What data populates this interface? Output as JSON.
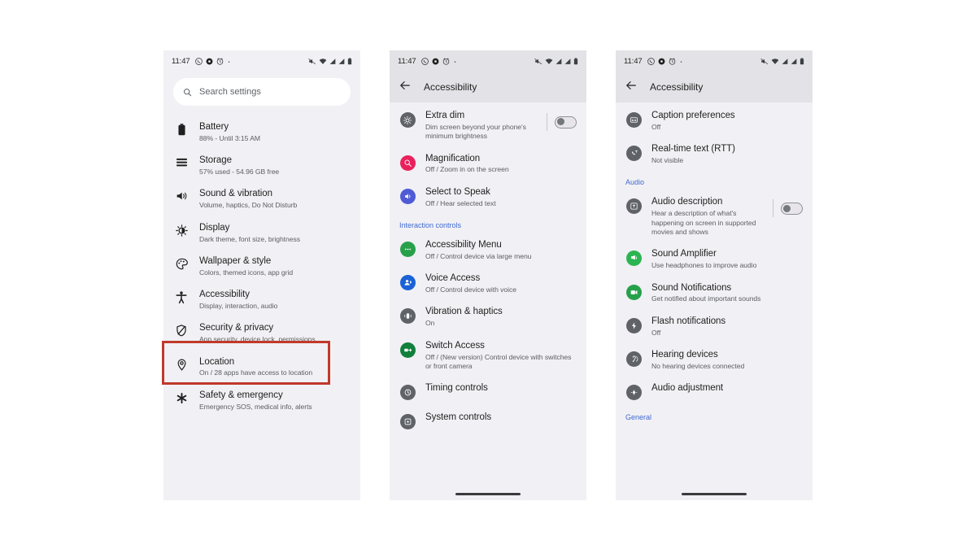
{
  "status_bar": {
    "time": "11:47",
    "left_icons": [
      "whatsapp-icon",
      "filled-circle-icon",
      "alarm-icon",
      "dot-icon"
    ],
    "right_icons": [
      "mute-icon",
      "wifi-icon",
      "signal-1-icon",
      "signal-2-icon",
      "battery-icon"
    ]
  },
  "colors": {
    "phone_bg": "#f1f0f4",
    "appbar_bg": "#e3e2e6",
    "highlight_red": "#c0392b",
    "section_blue": "#3f6ad1",
    "icon_grey": "#5f6368",
    "icon_pink": "#e8215c",
    "icon_blue_purple": "#4f5bd5",
    "icon_green": "#27a04a",
    "icon_blue": "#1a62d6",
    "icon_dark_green": "#11803c",
    "icon_light_green": "#2bb551"
  },
  "panel1": {
    "search": {
      "placeholder": "Search settings",
      "icon": "search-icon"
    },
    "items": [
      {
        "title": "Battery",
        "sub": "88% - Until 3:15 AM",
        "icon": "battery-icon"
      },
      {
        "title": "Storage",
        "sub": "57% used - 54.96 GB free",
        "icon": "storage-icon"
      },
      {
        "title": "Sound & vibration",
        "sub": "Volume, haptics, Do Not Disturb",
        "icon": "volume-icon"
      },
      {
        "title": "Display",
        "sub": "Dark theme, font size, brightness",
        "icon": "brightness-icon"
      },
      {
        "title": "Wallpaper & style",
        "sub": "Colors, themed icons, app grid",
        "icon": "palette-icon"
      },
      {
        "title": "Accessibility",
        "sub": "Display, interaction, audio",
        "icon": "accessibility-icon",
        "highlighted": true
      },
      {
        "title": "Security & privacy",
        "sub": "App security, device lock, permissions",
        "icon": "shield-icon"
      },
      {
        "title": "Location",
        "sub": "On / 28 apps have access to location",
        "icon": "location-pin-icon"
      },
      {
        "title": "Safety & emergency",
        "sub": "Emergency SOS, medical info, alerts",
        "icon": "asterisk-icon"
      }
    ]
  },
  "panel2": {
    "appbar": {
      "title": "Accessibility",
      "back_icon": "back-arrow-icon"
    },
    "items": [
      {
        "type": "item",
        "title": "Extra dim",
        "sub": "Dim screen beyond your phone's minimum brightness",
        "icon": "extra-dim-icon",
        "icon_color": "#5f6368",
        "toggle": "off"
      },
      {
        "type": "item",
        "title": "Magnification",
        "sub": "Off / Zoom in on the screen",
        "icon": "magnification-icon",
        "icon_color": "#e8215c"
      },
      {
        "type": "item",
        "title": "Select to Speak",
        "sub": "Off / Hear selected text",
        "icon": "select-to-speak-icon",
        "icon_color": "#4f5bd5"
      },
      {
        "type": "section",
        "title": "Interaction controls"
      },
      {
        "type": "item",
        "title": "Accessibility Menu",
        "sub": "Off / Control device via large menu",
        "icon": "accessibility-menu-icon",
        "icon_color": "#27a04a"
      },
      {
        "type": "item",
        "title": "Voice Access",
        "sub": "Off / Control device with voice",
        "icon": "voice-access-icon",
        "icon_color": "#1a62d6"
      },
      {
        "type": "item",
        "title": "Vibration & haptics",
        "sub": "On",
        "icon": "vibration-icon",
        "icon_color": "#5f6368"
      },
      {
        "type": "item",
        "title": "Switch Access",
        "sub": "Off / (New version) Control device with switches or front camera",
        "icon": "switch-access-icon",
        "icon_color": "#11803c"
      },
      {
        "type": "item",
        "title": "Timing controls",
        "sub": "",
        "icon": "timing-controls-icon",
        "icon_color": "#5f6368"
      },
      {
        "type": "item",
        "title": "System controls",
        "sub": "",
        "icon": "system-controls-icon",
        "icon_color": "#5f6368",
        "clipped": true
      }
    ]
  },
  "panel3": {
    "appbar": {
      "title": "Accessibility",
      "back_icon": "back-arrow-icon"
    },
    "items": [
      {
        "type": "item",
        "title": "Caption preferences",
        "sub": "Off",
        "icon": "caption-icon",
        "icon_color": "#5f6368"
      },
      {
        "type": "item",
        "title": "Real-time text (RTT)",
        "sub": "Not visible",
        "icon": "rtt-icon",
        "icon_color": "#5f6368"
      },
      {
        "type": "section",
        "title": "Audio"
      },
      {
        "type": "item",
        "title": "Audio description",
        "sub": "Hear a description of what's happening on screen in supported movies and shows",
        "icon": "audio-description-icon",
        "icon_color": "#5f6368",
        "toggle": "off"
      },
      {
        "type": "item",
        "title": "Sound Amplifier",
        "sub": "Use headphones to improve audio",
        "icon": "sound-amplifier-icon",
        "icon_color": "#2bb551"
      },
      {
        "type": "item",
        "title": "Sound Notifications",
        "sub": "Get notified about important sounds",
        "icon": "sound-notifications-icon",
        "icon_color": "#27a04a"
      },
      {
        "type": "item",
        "title": "Flash notifications",
        "sub": "Off",
        "icon": "flash-icon",
        "icon_color": "#5f6368"
      },
      {
        "type": "item",
        "title": "Hearing devices",
        "sub": "No hearing devices connected",
        "icon": "hearing-devices-icon",
        "icon_color": "#5f6368"
      },
      {
        "type": "item",
        "title": "Audio adjustment",
        "sub": "",
        "icon": "audio-adjustment-icon",
        "icon_color": "#5f6368"
      },
      {
        "type": "section",
        "title": "General",
        "clipped": true
      }
    ]
  }
}
